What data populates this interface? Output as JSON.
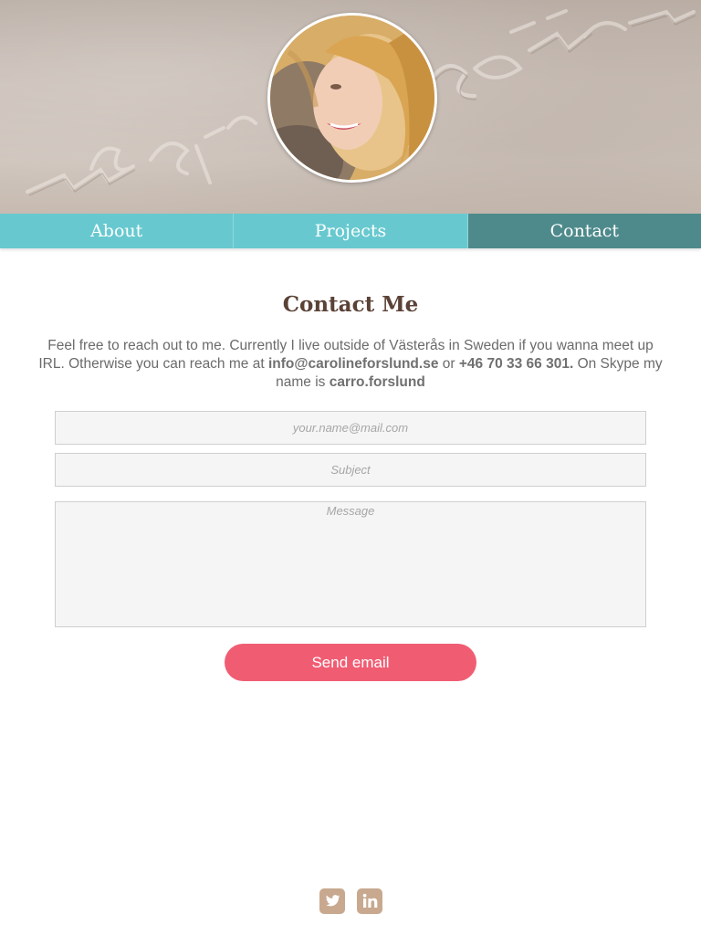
{
  "nav": {
    "items": [
      {
        "label": "About"
      },
      {
        "label": "Projects"
      },
      {
        "label": "Contact"
      }
    ],
    "active": "Contact"
  },
  "contact": {
    "title": "Contact Me",
    "intro_part1": "Feel free to reach out to me. Currently I live outside of Västerås in Sweden if you wanna meet up IRL. Otherwise you can reach me at ",
    "email": "info@carolineforslund.se",
    "intro_part2": " or ",
    "phone": "+46 70 33 66 301.",
    "intro_part3": " On Skype my name is ",
    "skype": "carro.forslund"
  },
  "form": {
    "email_placeholder": "your.name@mail.com",
    "subject_placeholder": "Subject",
    "message_placeholder": "Message",
    "send_label": "Send email"
  },
  "social": {
    "icons": [
      "twitter-icon",
      "linkedin-icon"
    ]
  },
  "colors": {
    "nav": "#67c9cf",
    "nav_active": "#4e8a8c",
    "accent": "#f05d73",
    "title": "#5b4236",
    "social": "#c8a98f"
  }
}
